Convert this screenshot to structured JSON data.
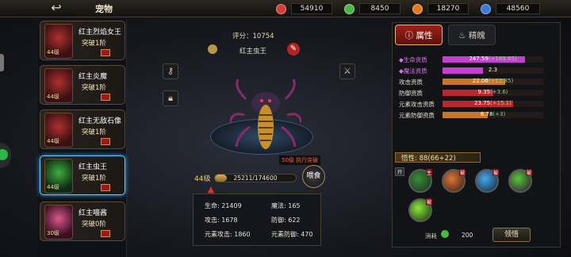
{
  "header": {
    "title": "宠物"
  },
  "resources": [
    {
      "icon": "red-gem-icon",
      "color": "#d93a3a",
      "value": "54910"
    },
    {
      "icon": "green-gem-icon",
      "color": "#4ab848",
      "value": "8450"
    },
    {
      "icon": "energy-icon",
      "color": "#e7781a",
      "value": "18270"
    },
    {
      "icon": "blue-crystal-icon",
      "color": "#3a7ad9",
      "value": "48560"
    }
  ],
  "pets": [
    {
      "name": "红主烈焰女王",
      "rank": "突破1阶",
      "level": "44级",
      "selected": false
    },
    {
      "name": "红主炎魔",
      "rank": "突破1阶",
      "level": "44级",
      "selected": false
    },
    {
      "name": "红主无敌石像",
      "rank": "突破1阶",
      "level": "44级",
      "selected": false
    },
    {
      "name": "红主虫王",
      "rank": "突破1阶",
      "level": "44级",
      "selected": true
    },
    {
      "name": "红主喵酱",
      "rank": "突破0阶",
      "level": "30级",
      "selected": false
    }
  ],
  "center": {
    "score": "评分：10754",
    "pet_name": "红主虫王",
    "skill_tag": "50级 执行突破",
    "level": "44级",
    "exp": "25211/174600",
    "exp_fraction": 0.144,
    "feed": "喂食",
    "stats": {
      "hp": "生命: 21409",
      "mp": "魔法: 165",
      "atk": "攻击: 1678",
      "def": "防御: 622",
      "elem_atk": "元素攻击: 1860",
      "elem_def": "元素防御: 470"
    }
  },
  "tabs": {
    "attr": "属性",
    "soul": "精魄"
  },
  "aptitudes": [
    {
      "label": "◆生命资质",
      "value": "247.59",
      "bonus": "(+189.65)",
      "fill": 0.82,
      "color": "#c53fd0",
      "highlight": true
    },
    {
      "label": "◆魔法资质",
      "value": "2.3",
      "bonus": "",
      "fill": 0.4,
      "color": "#c53fd0",
      "highlight": true
    },
    {
      "label": "攻击资质",
      "value": "22.06",
      "bonus": "(+12.85)",
      "fill": 0.62,
      "color": "#c8762a",
      "highlight": false
    },
    {
      "label": "防御资质",
      "value": "9.35",
      "bonus": "(+3.6)",
      "fill": 0.5,
      "color": "#b8282c",
      "highlight": false
    },
    {
      "label": "元素攻击资质",
      "value": "23.75",
      "bonus": "(+15.1)",
      "fill": 0.7,
      "color": "#b8282c",
      "highlight": false
    },
    {
      "label": "元素防御资质",
      "value": "6.78",
      "bonus": "(+3)",
      "fill": 0.45,
      "color": "#c8762a",
      "highlight": false
    }
  ],
  "wuxing": "悟性: 88(66+22)",
  "open_label": "开",
  "skills": [
    {
      "icon": "poison-skill-icon",
      "tag": "主"
    },
    {
      "icon": "claw-skill-icon",
      "tag": "被"
    },
    {
      "icon": "water-skill-icon",
      "tag": "被"
    },
    {
      "icon": "venom-skill-icon",
      "tag": "被"
    },
    {
      "icon": "toxic-skill-icon",
      "tag": "被"
    }
  ],
  "cost": {
    "label": "消耗",
    "value": "200"
  },
  "learn_button": "领悟"
}
